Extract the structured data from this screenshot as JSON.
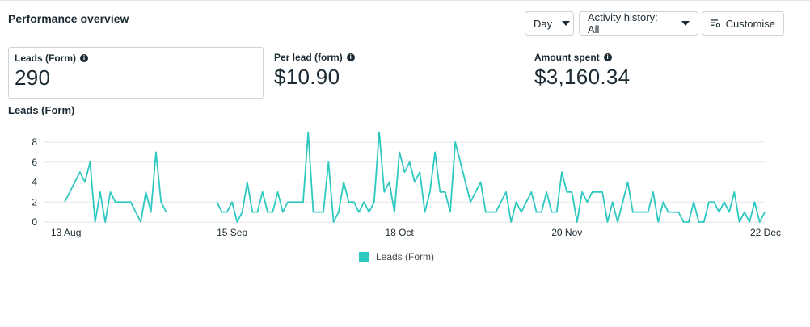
{
  "header": {
    "title": "Performance overview",
    "day_label": "Day",
    "activity_label": "Activity history: All",
    "customise_label": "Customise"
  },
  "metrics": [
    {
      "label": "Leads (Form)",
      "value": "290"
    },
    {
      "label": "Per lead (form)",
      "value": "$10.90"
    },
    {
      "label": "Amount spent",
      "value": "$3,160.34"
    }
  ],
  "chart_title": "Leads (Form)",
  "colors": {
    "series": "#2dc9c0",
    "grid": "#e4e6eb",
    "text": "#1c2b33"
  },
  "chart_data": {
    "type": "line",
    "title": "Leads (Form)",
    "x_tick_labels": [
      "13 Aug",
      "15 Sep",
      "18 Oct",
      "20 Nov",
      "22 Dec"
    ],
    "x_tick_indices": [
      0,
      33,
      66,
      99,
      132
    ],
    "y_ticks": [
      0,
      2,
      4,
      6,
      8
    ],
    "ylim": [
      0,
      9
    ],
    "grid": true,
    "legend": "bottom-center",
    "series": [
      {
        "name": "Leads (Form)",
        "values": [
          2,
          3,
          4,
          5,
          4,
          6,
          0,
          3,
          0,
          3,
          2,
          2,
          2,
          2,
          1,
          0,
          3,
          1,
          7,
          2,
          1,
          null,
          null,
          null,
          null,
          null,
          null,
          null,
          null,
          null,
          2,
          1,
          1,
          2,
          0,
          1,
          4,
          1,
          1,
          3,
          1,
          1,
          3,
          1,
          2,
          2,
          2,
          2,
          9,
          1,
          1,
          1,
          6,
          0,
          1,
          4,
          2,
          2,
          1,
          2,
          1,
          2,
          9,
          3,
          4,
          1,
          7,
          5,
          6,
          4,
          5,
          1,
          3,
          7,
          3,
          3,
          1,
          8,
          6,
          4,
          2,
          3,
          4,
          1,
          1,
          1,
          2,
          3,
          0,
          2,
          1,
          2,
          3,
          1,
          1,
          3,
          1,
          1,
          5,
          3,
          3,
          0,
          3,
          2,
          3,
          3,
          3,
          0,
          2,
          0,
          2,
          4,
          1,
          1,
          1,
          1,
          3,
          0,
          2,
          1,
          1,
          1,
          0,
          0,
          2,
          0,
          0,
          2,
          2,
          1,
          2,
          1,
          3,
          0,
          1,
          0,
          2,
          0,
          1
        ]
      }
    ]
  }
}
